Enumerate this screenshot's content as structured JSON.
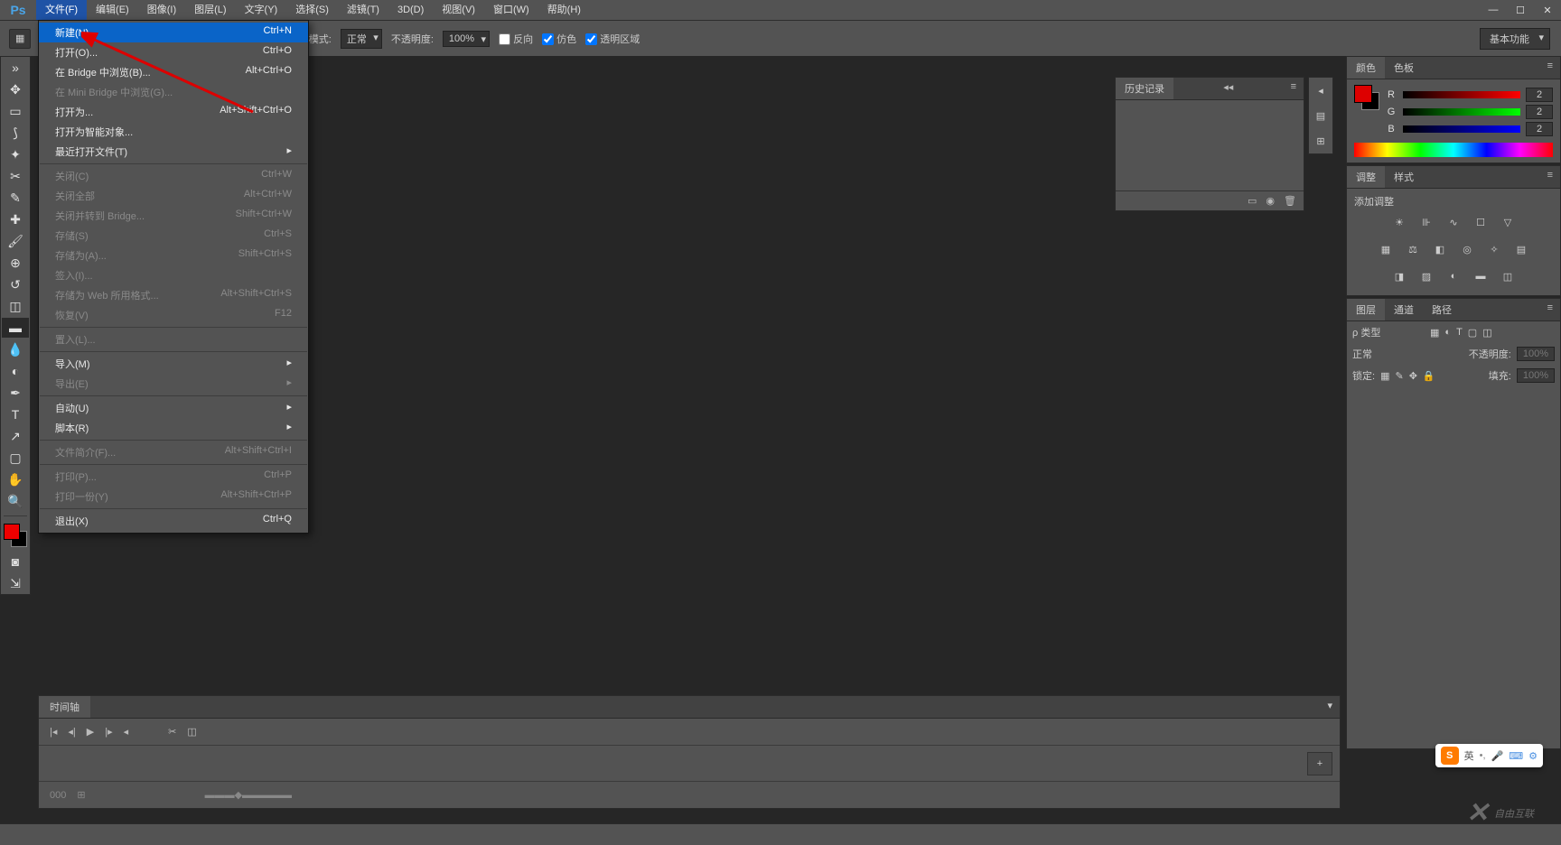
{
  "menubar": {
    "items": [
      "文件(F)",
      "编辑(E)",
      "图像(I)",
      "图层(L)",
      "文字(Y)",
      "选择(S)",
      "滤镜(T)",
      "3D(D)",
      "视图(V)",
      "窗口(W)",
      "帮助(H)"
    ],
    "active_index": 0
  },
  "file_menu": [
    {
      "label": "新建(N)...",
      "shortcut": "Ctrl+N",
      "hl": true
    },
    {
      "label": "打开(O)...",
      "shortcut": "Ctrl+O"
    },
    {
      "label": "在 Bridge 中浏览(B)...",
      "shortcut": "Alt+Ctrl+O"
    },
    {
      "label": "在 Mini Bridge 中浏览(G)...",
      "disabled": true
    },
    {
      "label": "打开为...",
      "shortcut": "Alt+Shift+Ctrl+O"
    },
    {
      "label": "打开为智能对象..."
    },
    {
      "label": "最近打开文件(T)",
      "sub": true
    },
    {
      "sep": true
    },
    {
      "label": "关闭(C)",
      "shortcut": "Ctrl+W",
      "disabled": true
    },
    {
      "label": "关闭全部",
      "shortcut": "Alt+Ctrl+W",
      "disabled": true
    },
    {
      "label": "关闭并转到 Bridge...",
      "shortcut": "Shift+Ctrl+W",
      "disabled": true
    },
    {
      "label": "存储(S)",
      "shortcut": "Ctrl+S",
      "disabled": true
    },
    {
      "label": "存储为(A)...",
      "shortcut": "Shift+Ctrl+S",
      "disabled": true
    },
    {
      "label": "签入(I)...",
      "disabled": true
    },
    {
      "label": "存储为 Web 所用格式...",
      "shortcut": "Alt+Shift+Ctrl+S",
      "disabled": true
    },
    {
      "label": "恢复(V)",
      "shortcut": "F12",
      "disabled": true
    },
    {
      "sep": true
    },
    {
      "label": "置入(L)...",
      "disabled": true
    },
    {
      "sep": true
    },
    {
      "label": "导入(M)",
      "sub": true
    },
    {
      "label": "导出(E)",
      "sub": true,
      "disabled": true
    },
    {
      "sep": true
    },
    {
      "label": "自动(U)",
      "sub": true
    },
    {
      "label": "脚本(R)",
      "sub": true
    },
    {
      "sep": true
    },
    {
      "label": "文件简介(F)...",
      "shortcut": "Alt+Shift+Ctrl+I",
      "disabled": true
    },
    {
      "sep": true
    },
    {
      "label": "打印(P)...",
      "shortcut": "Ctrl+P",
      "disabled": true
    },
    {
      "label": "打印一份(Y)",
      "shortcut": "Alt+Shift+Ctrl+P",
      "disabled": true
    },
    {
      "sep": true
    },
    {
      "label": "退出(X)",
      "shortcut": "Ctrl+Q"
    }
  ],
  "optionsbar": {
    "mode_label": "正常",
    "opacity_label": "不透明度:",
    "opacity_value": "100%",
    "reverse": "反向",
    "dither": "仿色",
    "transparent": "透明区域",
    "workspace": "基本功能"
  },
  "panels": {
    "history": {
      "title": "历史记录"
    },
    "color": {
      "tabs": [
        "颜色",
        "色板"
      ],
      "channels": [
        "R",
        "G",
        "B"
      ],
      "values": [
        "2",
        "2",
        "2"
      ]
    },
    "adjustments": {
      "tabs": [
        "调整",
        "样式"
      ],
      "add": "添加调整"
    },
    "layers": {
      "tabs": [
        "图层",
        "通道",
        "路径"
      ],
      "filter": "类型",
      "blend": "正常",
      "opacity_label": "不透明度:",
      "opacity_value": "100%",
      "lock_label": "锁定:",
      "fill_label": "填充:",
      "fill_value": "100%"
    }
  },
  "timeline": {
    "title": "时间轴"
  },
  "ime": {
    "lang": "英"
  },
  "watermark": "自由互联"
}
